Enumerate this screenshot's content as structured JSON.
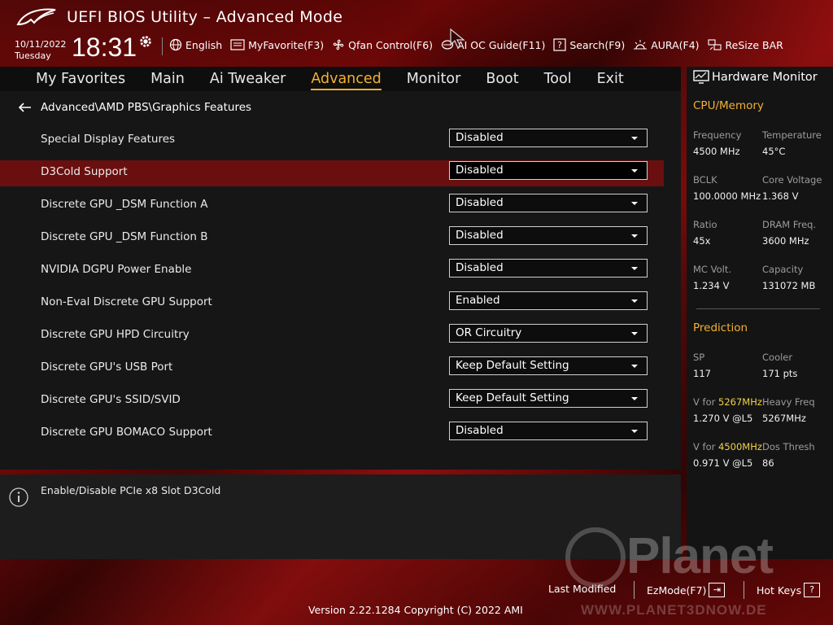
{
  "header": {
    "title": "UEFI BIOS Utility – Advanced Mode",
    "date": "10/11/2022",
    "day": "Tuesday",
    "time": "18:31",
    "tools": [
      {
        "label": "English",
        "icon": "globe-icon"
      },
      {
        "label": "MyFavorite(F3)",
        "icon": "favorite-list-icon"
      },
      {
        "label": "Qfan Control(F6)",
        "icon": "fan-icon"
      },
      {
        "label": "AI OC Guide(F11)",
        "icon": "ai-chip-icon"
      },
      {
        "label": "Search(F9)",
        "icon": "search-question-icon"
      },
      {
        "label": "AURA(F4)",
        "icon": "aura-light-icon"
      },
      {
        "label": "ReSize BAR",
        "icon": "resize-bar-icon"
      }
    ]
  },
  "nav": {
    "tabs": [
      "My Favorites",
      "Main",
      "Ai Tweaker",
      "Advanced",
      "Monitor",
      "Boot",
      "Tool",
      "Exit"
    ],
    "active": "Advanced"
  },
  "breadcrumb": "Advanced\\AMD PBS\\Graphics Features",
  "settings": [
    {
      "label": "Special Display Features",
      "value": "Disabled"
    },
    {
      "label": "D3Cold Support",
      "value": "Disabled"
    },
    {
      "label": "Discrete GPU _DSM Function A",
      "value": "Disabled"
    },
    {
      "label": "Discrete GPU _DSM Function B",
      "value": "Disabled"
    },
    {
      "label": "NVIDIA DGPU Power Enable",
      "value": "Disabled"
    },
    {
      "label": "Non-Eval Discrete GPU Support",
      "value": "Enabled"
    },
    {
      "label": "Discrete GPU HPD Circuitry",
      "value": "OR Circuitry"
    },
    {
      "label": "Discrete GPU's USB Port",
      "value": "Keep Default Setting"
    },
    {
      "label": "Discrete GPU's SSID/SVID",
      "value": "Keep Default Setting"
    },
    {
      "label": "Discrete GPU BOMACO Support",
      "value": "Disabled"
    }
  ],
  "selected_setting": "D3Cold Support",
  "help": {
    "text": "Enable/Disable PCIe x8 Slot D3Cold"
  },
  "hw_monitor": {
    "title": "Hardware Monitor",
    "cpu_memory": {
      "heading": "CPU/Memory",
      "frequency_label": "Frequency",
      "frequency_value": "4500 MHz",
      "temperature_label": "Temperature",
      "temperature_value": "45°C",
      "bclk_label": "BCLK",
      "bclk_value": "100.0000 MHz",
      "core_voltage_label": "Core Voltage",
      "core_voltage_value": "1.368 V",
      "ratio_label": "Ratio",
      "ratio_value": "45x",
      "dram_freq_label": "DRAM Freq.",
      "dram_freq_value": "3600 MHz",
      "mc_volt_label": "MC Volt.",
      "mc_volt_value": "1.234 V",
      "capacity_label": "Capacity",
      "capacity_value": "131072 MB"
    },
    "prediction": {
      "heading": "Prediction",
      "sp_label": "SP",
      "sp_value": "117",
      "cooler_label": "Cooler",
      "cooler_value": "171 pts",
      "v_for_1_prefix": "V for ",
      "v_for_1_freq": "5267MHz",
      "v_for_1_value": "1.270 V @L5",
      "heavy_freq_label": "Heavy Freq",
      "heavy_freq_value": "5267MHz",
      "v_for_2_prefix": "V for ",
      "v_for_2_freq": "4500MHz",
      "v_for_2_value": "0.971 V @L5",
      "dos_thresh_label": "Dos Thresh",
      "dos_thresh_value": "86"
    }
  },
  "footer": {
    "last_modified": "Last Modified",
    "ezmode": "EzMode(F7)",
    "ezmode_key": "⇥",
    "hot_keys": "Hot Keys",
    "hot_keys_key": "?",
    "version": "Version 2.22.1284 Copyright (C) 2022 AMI"
  },
  "watermark": {
    "brand": "Planet",
    "url": "WWW.PLANET3DNOW.DE"
  },
  "colors": {
    "accent": "#f2b134",
    "highlight_row": "#6a0f0f",
    "value_highlight": "#f2d24a"
  }
}
